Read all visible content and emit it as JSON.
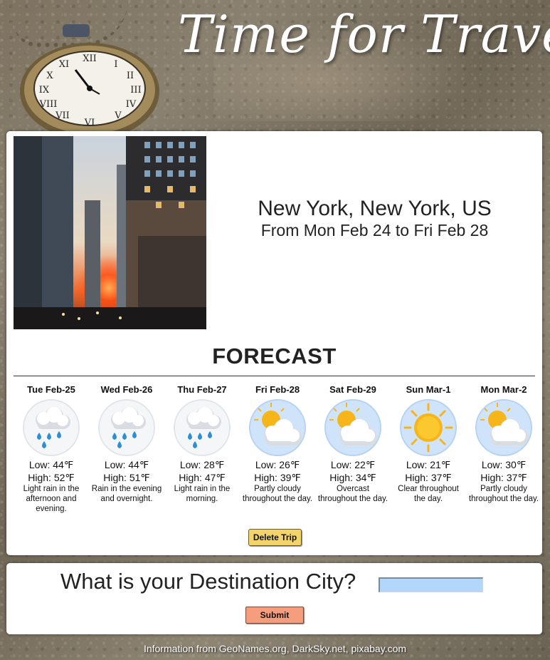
{
  "header": {
    "title": "Time for Travel"
  },
  "trip": {
    "city": "New York, New York, US",
    "dates": "From Mon Feb 24 to Fri Feb 28",
    "photo_icon": "city-street-sunset-photo"
  },
  "forecast": {
    "heading": "FORECAST",
    "days": [
      {
        "day": "Tue Feb-25",
        "icon": "rain-cloud-icon",
        "low": "Low: 44℉",
        "high": "High: 52℉",
        "summary": "Light rain in the afternoon and evening."
      },
      {
        "day": "Wed Feb-26",
        "icon": "rain-cloud-icon",
        "low": "Low: 44℉",
        "high": "High: 51℉",
        "summary": "Rain in the evening and overnight."
      },
      {
        "day": "Thu Feb-27",
        "icon": "rain-cloud-icon",
        "low": "Low: 28℉",
        "high": "High: 47℉",
        "summary": "Light rain in the morning."
      },
      {
        "day": "Fri Feb-28",
        "icon": "partly-cloudy-icon",
        "low": "Low: 26℉",
        "high": "High: 39℉",
        "summary": "Partly cloudy throughout the day."
      },
      {
        "day": "Sat Feb-29",
        "icon": "partly-cloudy-icon",
        "low": "Low: 22℉",
        "high": "High: 34℉",
        "summary": "Overcast throughout the day."
      },
      {
        "day": "Sun Mar-1",
        "icon": "sun-icon",
        "low": "Low: 21℉",
        "high": "High: 37℉",
        "summary": "Clear throughout the day."
      },
      {
        "day": "Mon Mar-2",
        "icon": "partly-cloudy-icon",
        "low": "Low: 30℉",
        "high": "High: 37℉",
        "summary": "Partly cloudy throughout the day."
      }
    ]
  },
  "actions": {
    "delete_label": "Delete Trip"
  },
  "search": {
    "label": "What is your Destination City?",
    "value": "",
    "placeholder": "",
    "submit_label": "Submit"
  },
  "footer": {
    "credits": "Information from GeoNames.org, DarkSky.net, pixabay.com"
  },
  "colors": {
    "delete_button": "#f2d46a",
    "submit_button": "#f59d7c",
    "input_background": "#b3d7fb",
    "icon_circle": "#cfe4fa",
    "sun": "#f6b619"
  }
}
